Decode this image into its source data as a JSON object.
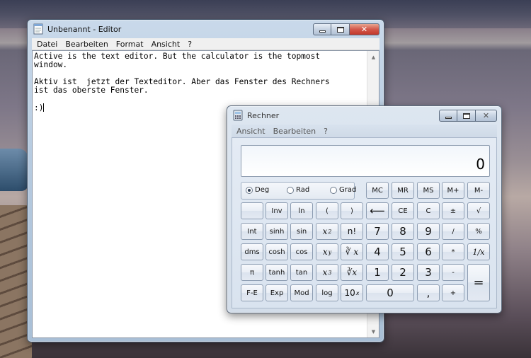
{
  "editor": {
    "title": "Unbenannt - Editor",
    "menu": [
      "Datei",
      "Bearbeiten",
      "Format",
      "Ansicht",
      "?"
    ],
    "text": "Active is the text editor. But the calculator is the topmost\nwindow.\n\nAktiv ist  jetzt der Texteditor. Aber das Fenster des Rechners\nist das oberste Fenster.\n\n:)"
  },
  "calculator": {
    "title": "Rechner",
    "menu": [
      "Ansicht",
      "Bearbeiten",
      "?"
    ],
    "display": "0",
    "angle_modes": [
      {
        "label": "Deg",
        "selected": true
      },
      {
        "label": "Rad",
        "selected": false
      },
      {
        "label": "Grad",
        "selected": false
      }
    ],
    "memory_row": [
      "MC",
      "MR",
      "MS",
      "M+",
      "M-"
    ],
    "keys": {
      "inv": "Inv",
      "ln": "ln",
      "lparen": "(",
      "rparen": ")",
      "back": "⟵",
      "ce": "CE",
      "c": "C",
      "plusminus": "±",
      "sqrt": "√",
      "int": "Int",
      "sinh": "sinh",
      "sin": "sin",
      "x": "x",
      "sq": "2",
      "fact": "n!",
      "n7": "7",
      "n8": "8",
      "n9": "9",
      "div": "/",
      "pct": "%",
      "dms": "dms",
      "cosh": "cosh",
      "cos": "cos",
      "y": "y",
      "yroot": "∛ x",
      "n4": "4",
      "n5": "5",
      "n6": "6",
      "mul": "*",
      "recip": "1/x",
      "pi": "π",
      "tanh": "tanh",
      "tan": "tan",
      "cube": "3",
      "cuberoot": "∛x",
      "n1": "1",
      "n2": "2",
      "n3": "3",
      "sub": "-",
      "eq": "=",
      "fe": "F-E",
      "exp": "Exp",
      "mod": "Mod",
      "log": "log",
      "ten": "10",
      "tenx": "x",
      "n0": "0",
      "dot": ",",
      "add": "+"
    }
  },
  "colors": {
    "close_button_active": "#c2392c",
    "window_frame": "#b7cbe0"
  },
  "icons": {
    "editor": "notepad-icon",
    "calculator": "calculator-icon",
    "minimize": "minimize-icon",
    "maximize": "maximize-icon",
    "close": "close-icon"
  }
}
